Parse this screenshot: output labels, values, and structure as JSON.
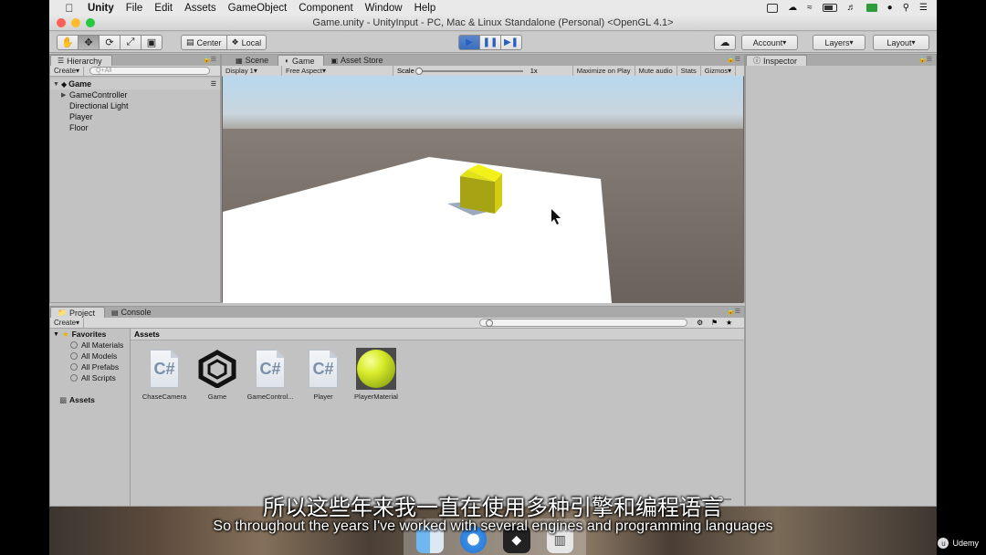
{
  "menubar": {
    "apple_icon": "apple-icon",
    "items": [
      "Unity",
      "File",
      "Edit",
      "Assets",
      "GameObject",
      "Component",
      "Window",
      "Help"
    ]
  },
  "window": {
    "title": "Game.unity - UnityInput - PC, Mac & Linux Standalone (Personal) <OpenGL 4.1>"
  },
  "toolbar": {
    "transform_tools": [
      "hand-icon",
      "move-icon",
      "rotate-icon",
      "scale-icon",
      "rect-icon"
    ],
    "pivot_center": "Center",
    "pivot_local": "Local",
    "play_controls": [
      "play-icon",
      "pause-icon",
      "step-icon"
    ],
    "account": "Account",
    "layers": "Layers",
    "layout": "Layout"
  },
  "hierarchy": {
    "tab": "Hierarchy",
    "create": "Create",
    "search_placeholder": "Q+All",
    "scene": "Game",
    "items": [
      "GameController",
      "Directional Light",
      "Player",
      "Floor"
    ]
  },
  "center": {
    "tabs": [
      "Scene",
      "Game",
      "Asset Store"
    ],
    "active_tab": "Game",
    "display": "Display 1",
    "aspect": "Free Aspect",
    "scale_label": "Scale",
    "scale_value": "1x",
    "maximize_on_play": "Maximize on Play",
    "mute_audio": "Mute audio",
    "stats": "Stats",
    "gizmos": "Gizmos"
  },
  "inspector": {
    "tab": "Inspector"
  },
  "project": {
    "tabs": [
      "Project",
      "Console"
    ],
    "create": "Create",
    "favorites": "Favorites",
    "favorite_items": [
      "All Materials",
      "All Models",
      "All Prefabs",
      "All Scripts"
    ],
    "assets_root": "Assets",
    "breadcrumb": "Assets",
    "assets": [
      {
        "name": "ChaseCamera",
        "kind": "script"
      },
      {
        "name": "Game",
        "kind": "unity-scene"
      },
      {
        "name": "GameControl...",
        "kind": "script"
      },
      {
        "name": "Player",
        "kind": "script"
      },
      {
        "name": "PlayerMaterial",
        "kind": "material"
      }
    ]
  },
  "subtitles": {
    "chinese": "所以这些年来我一直在使用多种引擎和编程语言",
    "english": "So throughout the years I've worked with several engines and programming languages"
  },
  "watermark": "Udemy",
  "colors": {
    "play_active": "#3a6fc0",
    "sky_top": "#b8d8ee",
    "ground": "#6b635c",
    "floor": "#ffffff",
    "cube": "#c8c810",
    "material": "#d8ec2a"
  }
}
